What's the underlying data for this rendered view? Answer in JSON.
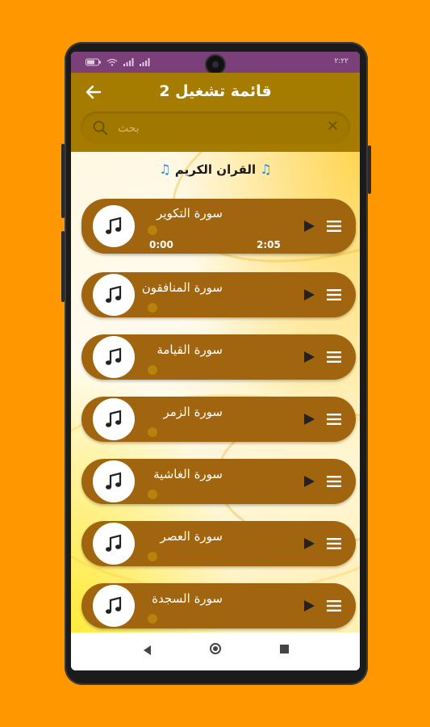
{
  "app": {
    "title": "قائمة تشغيل 2",
    "search_placeholder": "بحث",
    "section_title": "القران الكريم",
    "colors": {
      "background": "#FF9800",
      "status_bar": "#7B3F7A",
      "header": "#A67C00",
      "track_bg": "#A0650E",
      "note_icon": "#1e88e5"
    }
  },
  "status_bar": {
    "icons": [
      "battery-icon",
      "wifi-icon",
      "signal-icon",
      "signal-icon"
    ],
    "time": "٢:٢٢"
  },
  "tracks": [
    {
      "name": "سورة التكوير",
      "current_time": "0:00",
      "duration": "2:05",
      "playing": true
    },
    {
      "name": "سورة المنافقون"
    },
    {
      "name": "سورة القيامة"
    },
    {
      "name": "سورة الزمر"
    },
    {
      "name": "سورة الغاشية"
    },
    {
      "name": "سورة العصر"
    },
    {
      "name": "سورة السجدة"
    }
  ],
  "navigation": {
    "icons": [
      "nav-back-icon",
      "nav-home-icon",
      "nav-recents-icon"
    ]
  }
}
